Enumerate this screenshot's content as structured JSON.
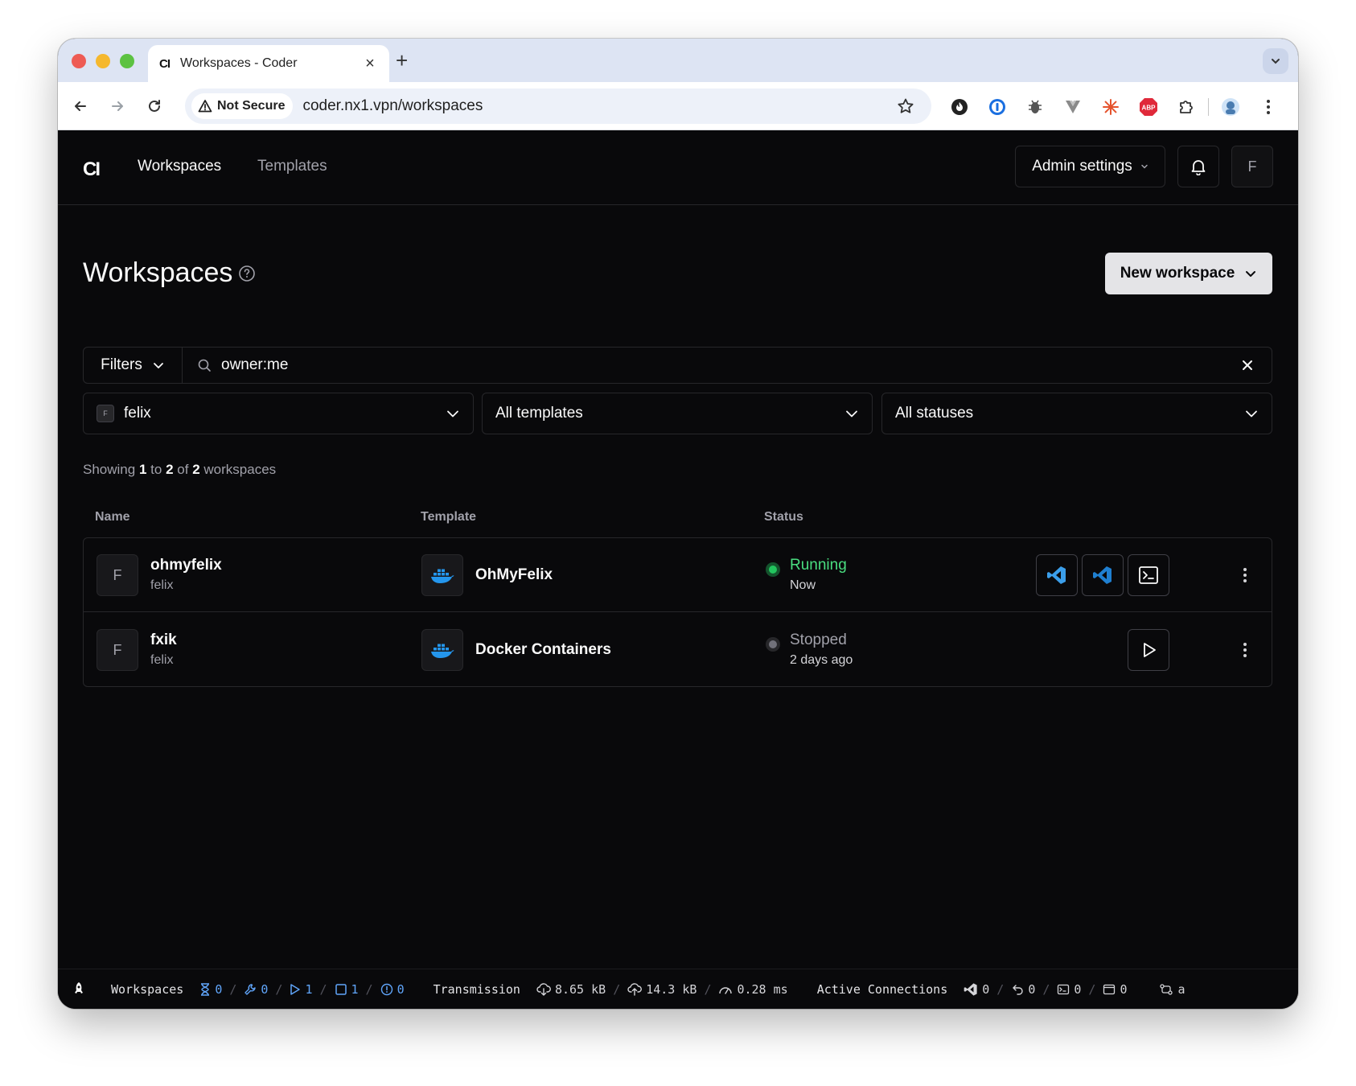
{
  "browser": {
    "tab_title": "Workspaces - Coder",
    "tab_favicon": "CI",
    "new_tab": "+",
    "not_secure_label": "Not Secure",
    "url": "coder.nx1.vpn/workspaces",
    "extensions": [
      "flame-extension-icon",
      "password-manager-icon",
      "bug-extension-icon",
      "vue-devtools-icon",
      "asterisk-extension-icon",
      "adblock-icon",
      "puzzle-extensions-icon",
      "profile-avatar-icon"
    ]
  },
  "header": {
    "logo": "CI",
    "nav": [
      "Workspaces",
      "Templates"
    ],
    "admin_settings": "Admin settings",
    "user_initial": "F"
  },
  "page": {
    "title": "Workspaces",
    "new_workspace": "New workspace",
    "filters_label": "Filters",
    "search_value": "owner:me",
    "owner_select": {
      "initial": "F",
      "value": "felix"
    },
    "template_select": "All templates",
    "status_select": "All statuses",
    "showing": {
      "prefix": "Showing",
      "from": "1",
      "to_word": "to",
      "to": "2",
      "of_word": "of",
      "total": "2",
      "suffix": "workspaces"
    }
  },
  "table": {
    "headers": [
      "Name",
      "Template",
      "Status"
    ],
    "rows": [
      {
        "initial": "F",
        "name": "ohmyfelix",
        "owner": "felix",
        "template": "OhMyFelix",
        "status": "Running",
        "time": "Now",
        "status_color": "#4ade80"
      },
      {
        "initial": "F",
        "name": "fxik",
        "owner": "felix",
        "template": "Docker Containers",
        "status": "Stopped",
        "time": "2 days ago",
        "status_color": "#a1a1aa"
      }
    ]
  },
  "statusbar": {
    "workspaces_label": "Workspaces",
    "pending": "0",
    "building": "0",
    "running": "1",
    "stopped": "1",
    "errors": "0",
    "transmission_label": "Transmission",
    "download": "8.65 kB",
    "upload": "14.3 kB",
    "latency": "0.28 ms",
    "connections_label": "Active Connections",
    "vscode": "0",
    "port_forward": "0",
    "terminal": "0",
    "apps": "0",
    "trailing": "a"
  }
}
